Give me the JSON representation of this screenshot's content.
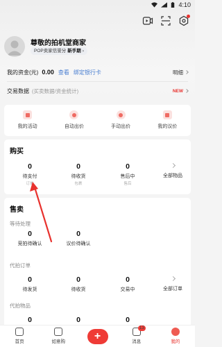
{
  "status_bar": {
    "time": "4:10"
  },
  "profile": {
    "name": "尊敬的拍机堂商家",
    "score_tag": "POP卖家信誉分",
    "score_level": "新手期",
    "score_chevron": "›"
  },
  "funds": {
    "label": "我的资金(元)",
    "amount": "0.00",
    "view_link": "查看",
    "bind_card": "绑定银行卡",
    "detail": "明细"
  },
  "trade": {
    "label": "交易数据",
    "sub": "(买卖数据/资金统计)",
    "badge": "NEW"
  },
  "activities": [
    {
      "label": "我的活动",
      "icon": "activity-icon"
    },
    {
      "label": "自动出价",
      "icon": "auto-bid-icon"
    },
    {
      "label": "手动出价",
      "icon": "manual-bid-icon"
    },
    {
      "label": "我的议价",
      "icon": "bargain-icon"
    }
  ],
  "buy": {
    "title": "购买",
    "stats": [
      {
        "num": "0",
        "label": "待支付",
        "sub": "订单"
      },
      {
        "num": "0",
        "label": "待收货",
        "sub": "包裹"
      },
      {
        "num": "0",
        "label": "售后中",
        "sub": "售后"
      }
    ],
    "all": "全部物品"
  },
  "sell": {
    "title": "售卖",
    "pending_section": "等待处理",
    "pending": [
      {
        "num": "0",
        "label": "竞拍待确认"
      },
      {
        "num": "0",
        "label": "议价待确认"
      }
    ],
    "orders_section": "代拍订单",
    "orders": [
      {
        "num": "0",
        "label": "待发货"
      },
      {
        "num": "0",
        "label": "待收货"
      },
      {
        "num": "0",
        "label": "交易中"
      }
    ],
    "all_orders": "全部订单",
    "items_section": "代拍物品",
    "items": [
      {
        "num": "0"
      },
      {
        "num": "0"
      },
      {
        "num": "0"
      }
    ]
  },
  "tabs": [
    {
      "label": "首页"
    },
    {
      "label": "如意购"
    },
    {
      "label": "+"
    },
    {
      "label": "消息",
      "badge": "13"
    },
    {
      "label": "我的"
    }
  ],
  "colors": {
    "accent": "#e8322e",
    "link": "#4a7fd1",
    "annotation_arrow": "#e8322e"
  }
}
